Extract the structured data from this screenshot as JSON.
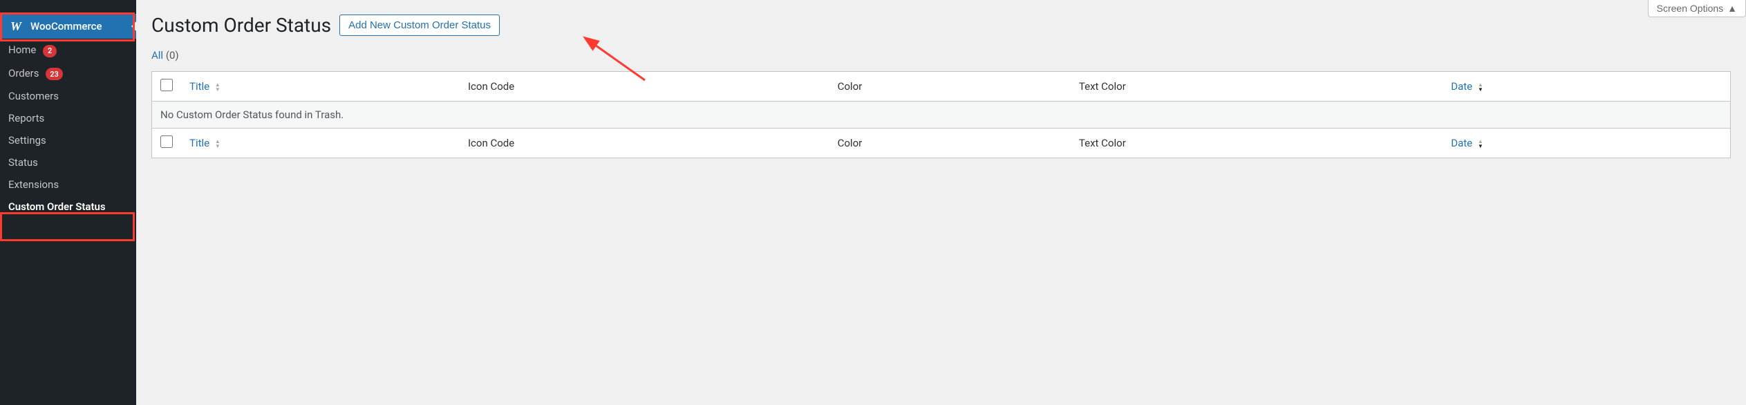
{
  "sidebar": {
    "active_label": "WooCommerce",
    "items": [
      {
        "label": "Home",
        "badge": "2"
      },
      {
        "label": "Orders",
        "badge": "23"
      },
      {
        "label": "Customers"
      },
      {
        "label": "Reports"
      },
      {
        "label": "Settings"
      },
      {
        "label": "Status"
      },
      {
        "label": "Extensions"
      },
      {
        "label": "Custom Order Status",
        "highlighted": true
      }
    ]
  },
  "header": {
    "screen_options": "Screen Options",
    "title": "Custom Order Status",
    "add_button": "Add New Custom Order Status"
  },
  "filters": {
    "all_label": "All",
    "all_count": "(0)"
  },
  "table": {
    "columns": {
      "title": "Title",
      "icon_code": "Icon Code",
      "color": "Color",
      "text_color": "Text Color",
      "date": "Date"
    },
    "empty_msg": "No Custom Order Status found in Trash."
  }
}
